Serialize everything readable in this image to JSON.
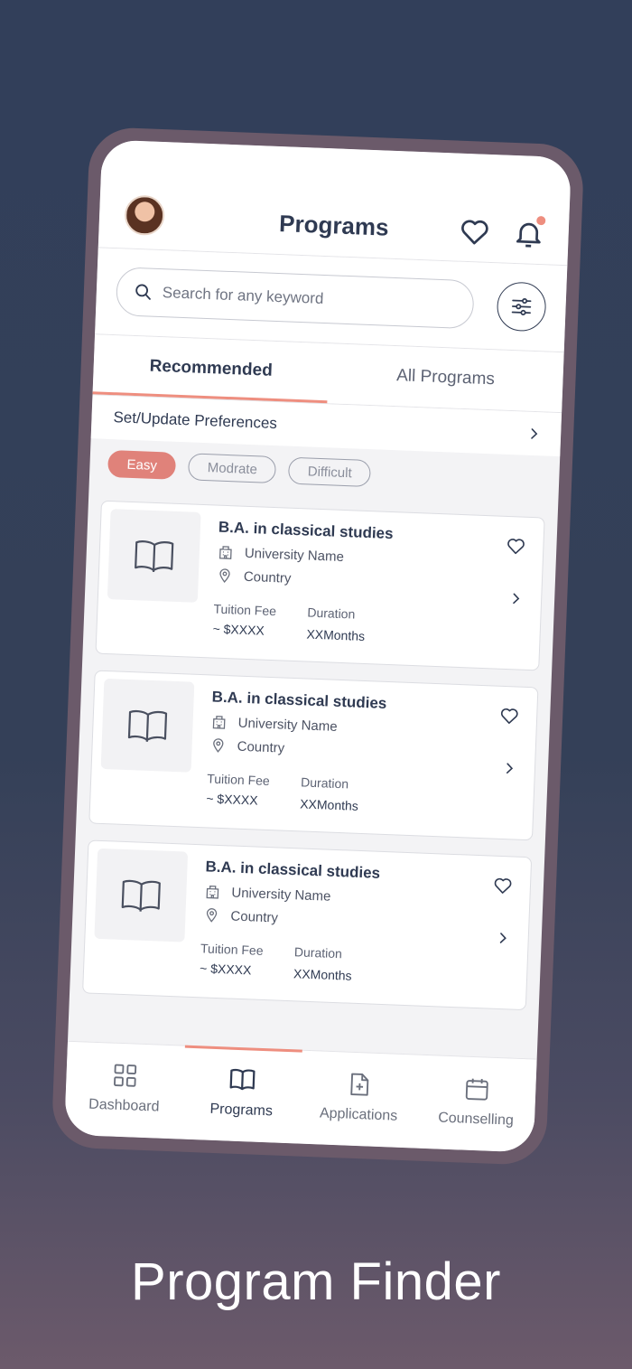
{
  "header": {
    "title": "Programs",
    "icons": [
      "avatar",
      "heart-icon",
      "bell-icon"
    ]
  },
  "search": {
    "placeholder": "Search for any keyword",
    "value": ""
  },
  "tabs": [
    {
      "label": "Recommended",
      "active": true
    },
    {
      "label": "All Programs",
      "active": false
    }
  ],
  "preferences": {
    "label": "Set/Update Preferences"
  },
  "chips": [
    {
      "label": "Easy",
      "active": true
    },
    {
      "label": "Modrate",
      "active": false
    },
    {
      "label": "Difficult",
      "active": false
    }
  ],
  "programs": [
    {
      "title": "B.A. in classical studies",
      "university": "University Name",
      "country": "Country",
      "fee_label": "Tuition Fee",
      "fee_value": "~ $XXXX",
      "duration_label": "Duration",
      "duration_value": "XXMonths"
    },
    {
      "title": "B.A. in classical studies",
      "university": "University Name",
      "country": "Country",
      "fee_label": "Tuition Fee",
      "fee_value": "~ $XXXX",
      "duration_label": "Duration",
      "duration_value": "XXMonths"
    },
    {
      "title": "B.A. in classical studies",
      "university": "University Name",
      "country": "Country",
      "fee_label": "Tuition Fee",
      "fee_value": "~ $XXXX",
      "duration_label": "Duration",
      "duration_value": "XXMonths"
    }
  ],
  "bottom_nav": [
    {
      "label": "Dashboard",
      "icon": "grid-icon",
      "active": false
    },
    {
      "label": "Programs",
      "icon": "book-icon",
      "active": true
    },
    {
      "label": "Applications",
      "icon": "file-plus-icon",
      "active": false
    },
    {
      "label": "Counselling",
      "icon": "calendar-icon",
      "active": false
    }
  ],
  "caption": "Program Finder",
  "colors": {
    "accent": "#ee8e7f",
    "primary_text": "#2f3a52",
    "background_top": "#323f5a",
    "phone_frame": "#6b5a6a"
  }
}
